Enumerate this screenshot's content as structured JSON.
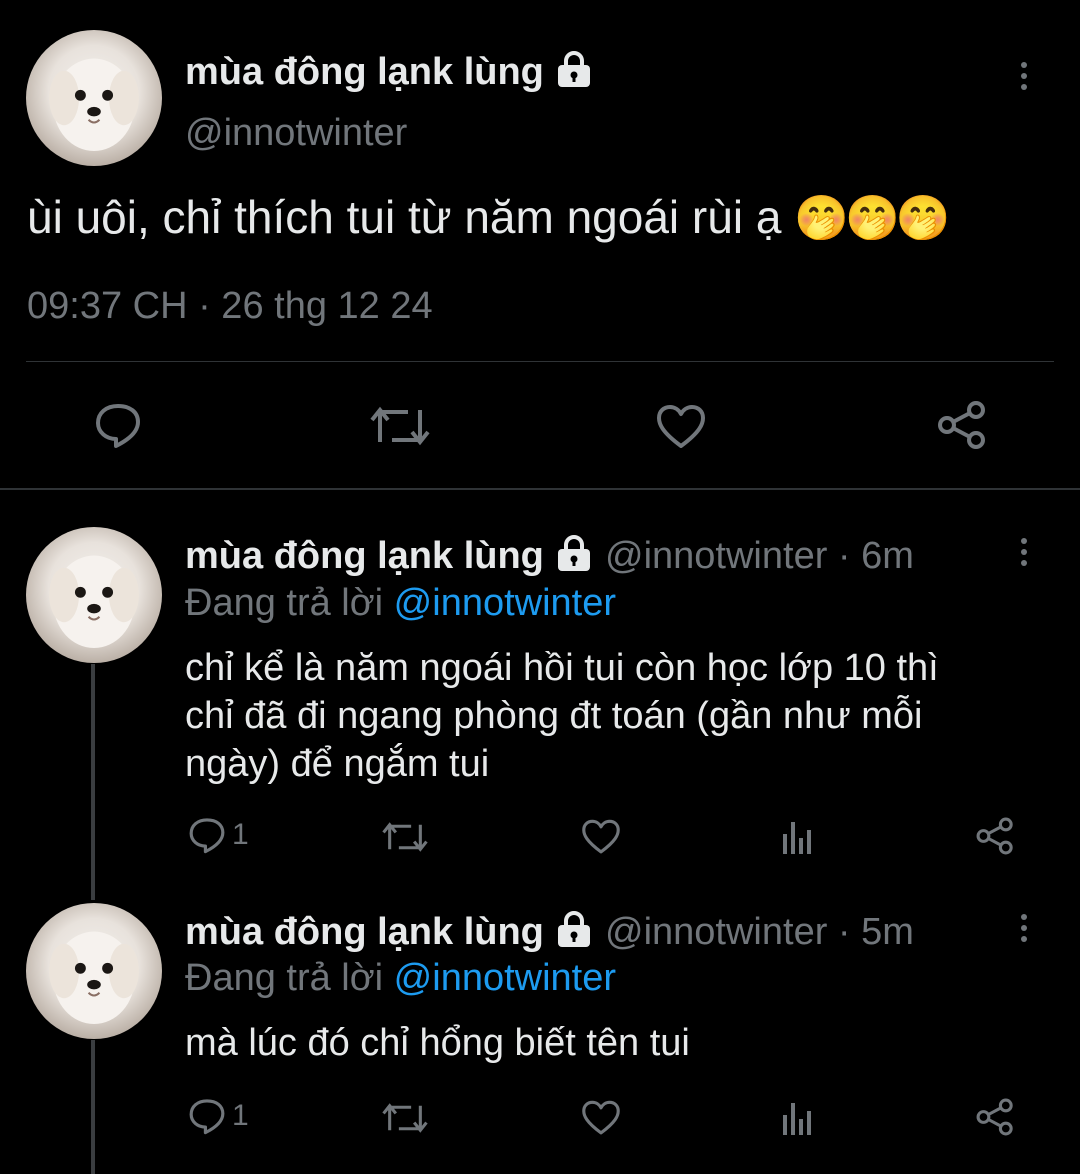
{
  "main_tweet": {
    "display_name": "mùa đông lạnk lùng",
    "handle": "@innotwinter",
    "text": "ùi uôi, chỉ thích tui từ năm ngoái rùi ạ",
    "emoji": "🤭🤭🤭",
    "timestamp": "09:37 CH · 26 thg 12 24",
    "actions": [
      "reply-icon",
      "retweet-icon",
      "like-icon",
      "share-icon"
    ]
  },
  "replies": [
    {
      "display_name": "mùa đông lạnk lùng",
      "handle_time": "@innotwinter · 6m",
      "replying_prefix": "Đang trả lời",
      "replying_to": "@innotwinter",
      "text_lines": [
        "chỉ kể là năm ngoái hồi tui còn học lớp 10 thì",
        "chỉ đã đi ngang phòng đt toán (gần như mỗi",
        "ngày) để ngắm tui"
      ],
      "reply_count": "1"
    },
    {
      "display_name": "mùa đông lạnk lùng",
      "handle_time": "@innotwinter · 5m",
      "replying_prefix": "Đang trả lời",
      "replying_to": "@innotwinter",
      "text_lines": [
        "mà lúc đó chỉ hổng biết tên tui"
      ],
      "reply_count": "1"
    }
  ],
  "colors": {
    "background": "#000000",
    "text": "#e7e9ea",
    "muted": "#71767b",
    "link": "#1d9bf0",
    "divider": "#2f3336"
  }
}
